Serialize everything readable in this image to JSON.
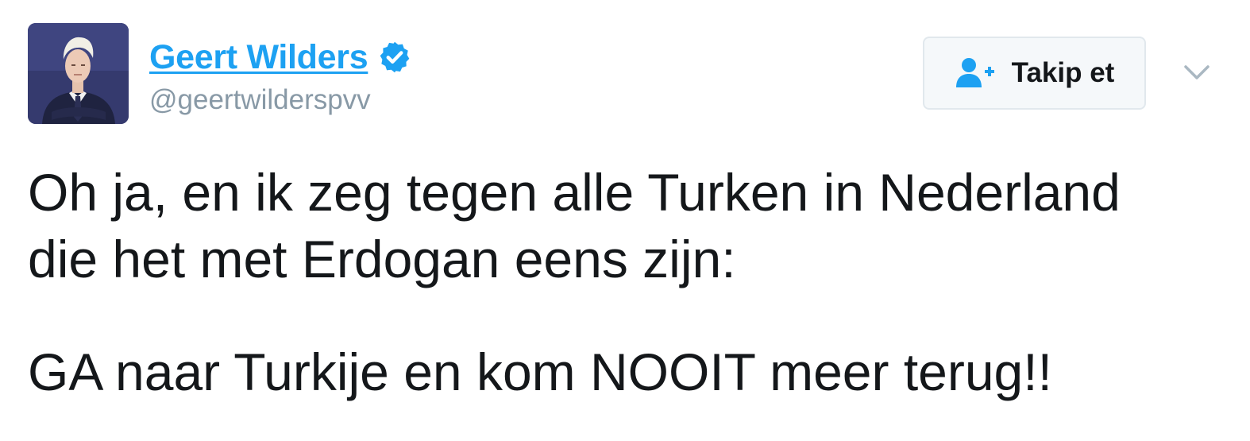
{
  "author": {
    "display_name": "Geert Wilders",
    "handle": "@geertwilderspvv",
    "verified": true,
    "avatar_icon": "person-portrait"
  },
  "follow_button": {
    "label": "Takip et",
    "icon": "add-user-icon"
  },
  "menu": {
    "icon": "chevron-down-icon"
  },
  "tweet": {
    "lines": [
      "Oh ja, en ik zeg tegen alle Turken in Nederland",
      "die het met Erdogan eens zijn:",
      "GA naar Turkije en kom NOOIT meer terug!!"
    ]
  },
  "colors": {
    "link_blue": "#1da1f2",
    "handle_gray": "#8899a6",
    "text": "#14171a",
    "button_bg": "#f5f8fa",
    "button_border": "#e1e8ed"
  }
}
